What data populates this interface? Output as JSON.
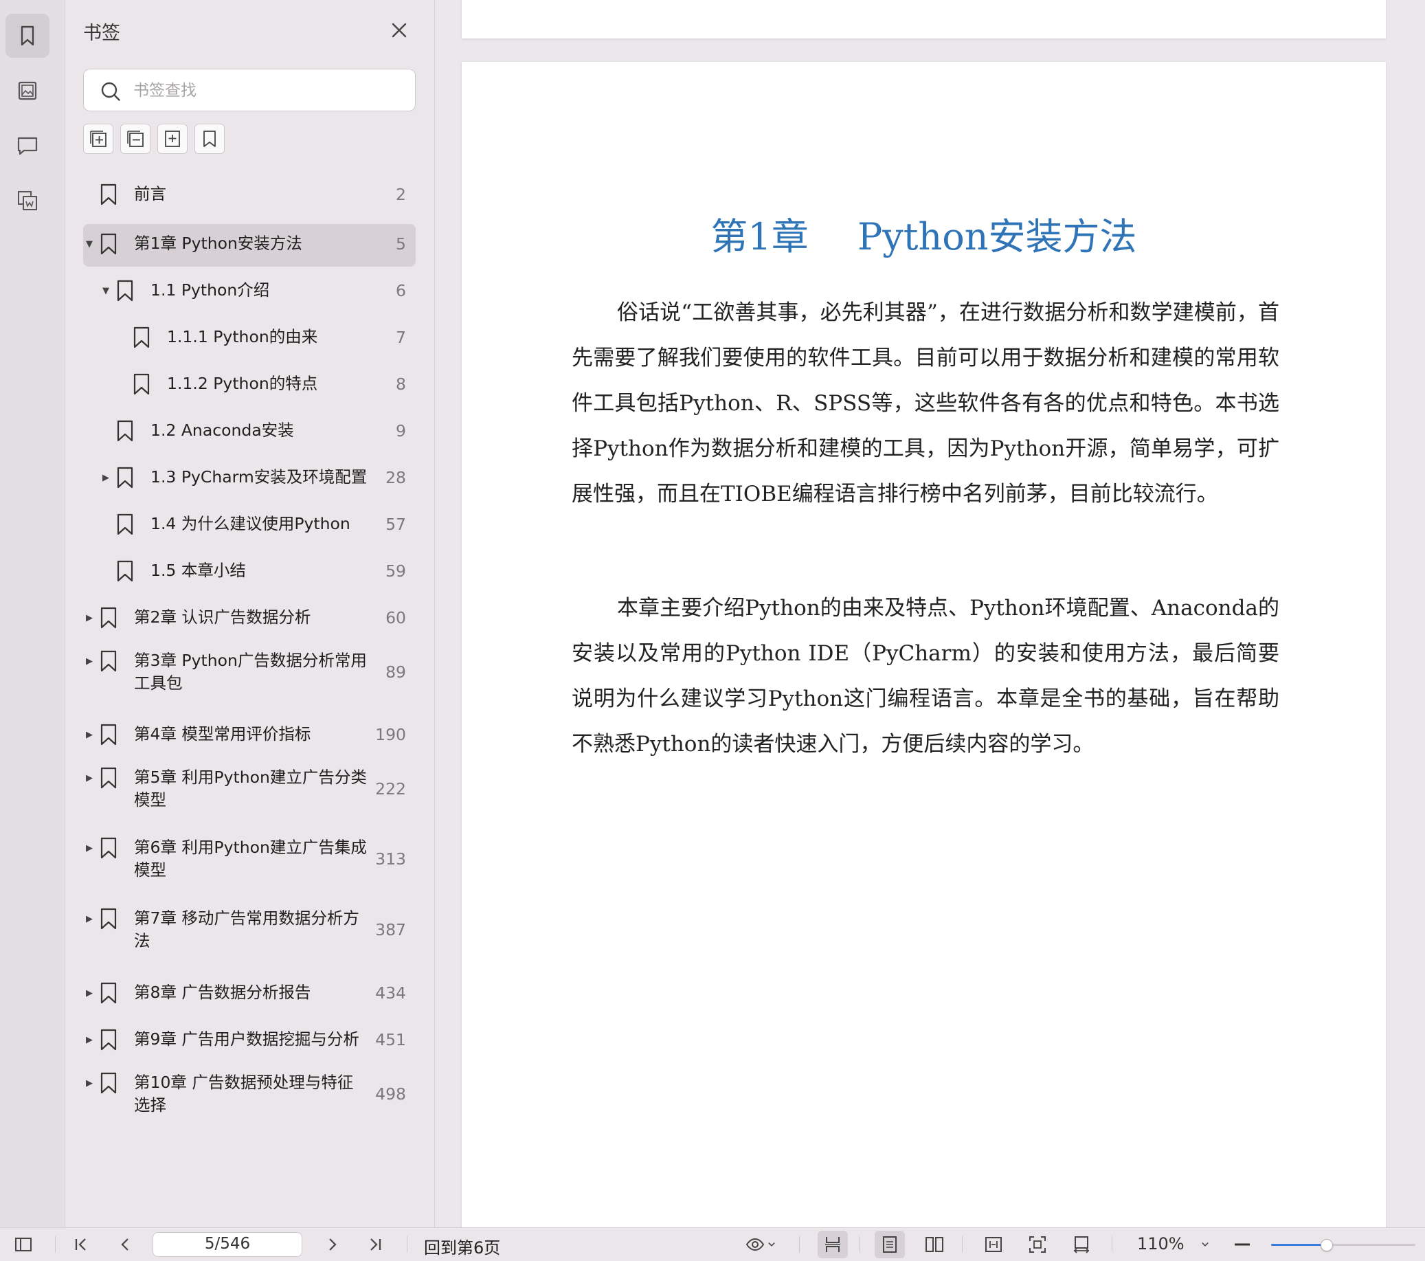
{
  "sidebar_panel": {
    "title": "书签",
    "search_placeholder": "书签查找"
  },
  "bookmarks": [
    {
      "label": "前言",
      "page": "2",
      "level": 0,
      "toggle": "none",
      "selected": false
    },
    {
      "label": "第1章 Python安装方法",
      "page": "5",
      "level": 0,
      "toggle": "expanded",
      "selected": true
    },
    {
      "label": "1.1 Python介绍",
      "page": "6",
      "level": 1,
      "toggle": "expanded",
      "selected": false
    },
    {
      "label": "1.1.1 Python的由来",
      "page": "7",
      "level": 2,
      "toggle": "none",
      "selected": false
    },
    {
      "label": "1.1.2 Python的特点",
      "page": "8",
      "level": 2,
      "toggle": "none",
      "selected": false
    },
    {
      "label": "1.2 Anaconda安装",
      "page": "9",
      "level": 1,
      "toggle": "none",
      "selected": false
    },
    {
      "label": "1.3 PyCharm安装及环境配置",
      "page": "28",
      "level": 1,
      "toggle": "collapsed",
      "selected": false
    },
    {
      "label": "1.4 为什么建议使用Python",
      "page": "57",
      "level": 1,
      "toggle": "none",
      "selected": false
    },
    {
      "label": "1.5 本章小结",
      "page": "59",
      "level": 1,
      "toggle": "none",
      "selected": false
    },
    {
      "label": "第2章 认识广告数据分析",
      "page": "60",
      "level": 0,
      "toggle": "collapsed",
      "selected": false
    },
    {
      "label": "第3章 Python广告数据分析常用工具包",
      "page": "89",
      "level": 0,
      "toggle": "collapsed",
      "selected": false
    },
    {
      "label": "第4章 模型常用评价指标",
      "page": "190",
      "level": 0,
      "toggle": "collapsed",
      "selected": false
    },
    {
      "label": "第5章 利用Python建立广告分类模型",
      "page": "222",
      "level": 0,
      "toggle": "collapsed",
      "selected": false
    },
    {
      "label": "第6章 利用Python建立广告集成模型",
      "page": "313",
      "level": 0,
      "toggle": "collapsed",
      "selected": false
    },
    {
      "label": "第7章 移动广告常用数据分析方法",
      "page": "387",
      "level": 0,
      "toggle": "collapsed",
      "selected": false
    },
    {
      "label": "第8章 广告数据分析报告",
      "page": "434",
      "level": 0,
      "toggle": "collapsed",
      "selected": false
    },
    {
      "label": "第9章 广告用户数据挖掘与分析",
      "page": "451",
      "level": 0,
      "toggle": "collapsed",
      "selected": false
    },
    {
      "label": "第10章 广告数据预处理与特征选择",
      "page": "498",
      "level": 0,
      "toggle": "collapsed",
      "selected": false
    }
  ],
  "document": {
    "chapter_title": "第1章　 Python安装方法",
    "paragraph_1": "俗话说“工欲善其事，必先利其器”，在进行数据分析和数学建模前，首先需要了解我们要使用的软件工具。目前可以用于数据分析和建模的常用软件工具包括Python、R、SPSS等，这些软件各有各的优点和特色。本书选择Python作为数据分析和建模的工具，因为Python开源，简单易学，可扩展性强，而且在TIOBE编程语言排行榜中名列前茅，目前比较流行。",
    "paragraph_2": "本章主要介绍Python的由来及特点、Python环境配置、Anaconda的安装以及常用的Python IDE（PyCharm）的安装和使用方法，最后简要说明为什么建议学习Python这门编程语言。本章是全书的基础，旨在帮助不熟悉Python的读者快速入门，方便后续内容的学习。"
  },
  "status_bar": {
    "page_indicator": "5/546",
    "goto_text": "回到第6页",
    "zoom": "110%",
    "zoom_slider_fraction": 0.38
  },
  "colors": {
    "accent": "#3a7bdc",
    "chapter_title": "#2f74b6"
  }
}
